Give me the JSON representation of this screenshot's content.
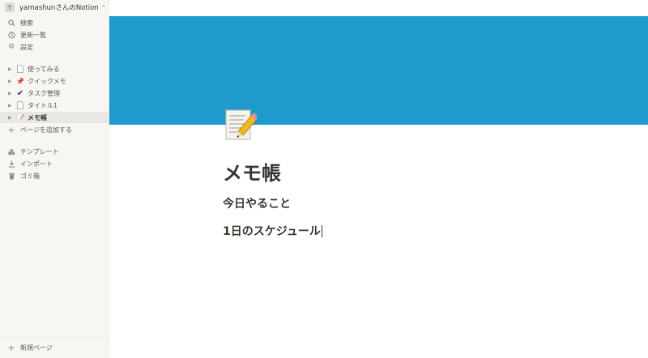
{
  "workspace": {
    "avatar": "Y",
    "name": "yamashunさんのNotion",
    "chevron_icon": "chevron-up-down-icon"
  },
  "top_nav": [
    {
      "label": "検索",
      "icon": "search-icon"
    },
    {
      "label": "更新一覧",
      "icon": "clock-icon"
    },
    {
      "label": "設定",
      "icon": "gear-icon"
    }
  ],
  "pages": [
    {
      "label": "使ってみる",
      "icon": "page-icon"
    },
    {
      "label": "クイックメモ",
      "icon": "pushpin-icon"
    },
    {
      "label": "タスク管理",
      "icon": "checkmark-icon"
    },
    {
      "label": "タイトル1",
      "icon": "page-icon"
    },
    {
      "label": "メモ帳",
      "icon": "memo-icon",
      "active": true
    }
  ],
  "add_page": "ページを追加する",
  "tools": [
    {
      "label": "テンプレート",
      "icon": "template-icon"
    },
    {
      "label": "インポート",
      "icon": "import-icon"
    },
    {
      "label": "ゴミ箱",
      "icon": "trash-icon"
    }
  ],
  "new_page": "新規ページ",
  "page": {
    "cover_color": "#1e9bcc",
    "icon": "memo-icon",
    "title": "メモ帳",
    "headings": [
      "今日やること",
      "1日のスケジュール"
    ]
  }
}
